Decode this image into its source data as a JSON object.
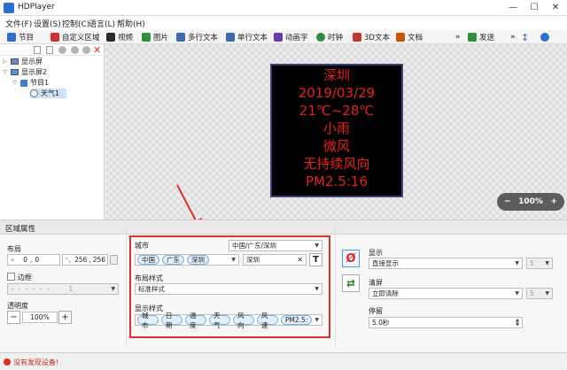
{
  "window": {
    "title": "HDPlayer",
    "controls": [
      "—",
      "☐",
      "✕"
    ]
  },
  "menu": [
    "文件(F)",
    "设置(S)",
    "控制(C)",
    "语言(L)",
    "帮助(H)"
  ],
  "toolbar": {
    "items": [
      {
        "label": "节目",
        "icon": "program-icon",
        "color": "#2e6fd0"
      },
      {
        "label": "自定义区域",
        "icon": "custom-area-icon",
        "color": "#d03030"
      },
      {
        "label": "视频",
        "icon": "video-icon",
        "color": "#2a2a2a"
      },
      {
        "label": "图片",
        "icon": "image-icon",
        "color": "#2f8f3a"
      },
      {
        "label": "多行文本",
        "icon": "multiline-text-icon",
        "color": "#3a6db0"
      },
      {
        "label": "单行文本",
        "icon": "single-line-text-icon",
        "color": "#3a6db0"
      },
      {
        "label": "动画字",
        "icon": "animated-text-icon",
        "color": "#6a3ab0"
      },
      {
        "label": "时钟",
        "icon": "clock-icon",
        "color": "#2f8f3a"
      },
      {
        "label": "3D文本",
        "icon": "3d-text-icon",
        "color": "#c0392b"
      },
      {
        "label": "文档",
        "icon": "document-icon",
        "color": "#d35400"
      }
    ],
    "send_label": "发送"
  },
  "tree": {
    "items": [
      {
        "label": "显示屏",
        "level": 0,
        "expanded": false
      },
      {
        "label": "显示屏2",
        "level": 0,
        "expanded": true
      },
      {
        "label": "节目1",
        "level": 1,
        "expanded": true
      },
      {
        "label": "天气1",
        "level": 2,
        "selected": true
      }
    ]
  },
  "led": {
    "lines": [
      "深圳",
      "2019/03/29",
      "21℃~28℃",
      "小雨",
      "微风",
      "无持续风向",
      "PM2.5:16"
    ],
    "text_color": "#e8211c"
  },
  "zoom": {
    "minus": "−",
    "value": "100%",
    "plus": "+"
  },
  "props": {
    "title": "区域属性",
    "layout_label": "布局",
    "x": "0",
    "y": "0",
    "width": "256",
    "height": "256",
    "border_label": "边框",
    "border_value": "1",
    "opacity_label": "透明度",
    "opacity_value": "100%",
    "city_label": "城市",
    "city_select": "中国/广东/深圳",
    "city_tags": [
      "中国",
      "广东",
      "深圳"
    ],
    "city_search": "深圳",
    "layout_style_label": "布局样式",
    "layout_style_value": "标准样式",
    "display_style_label": "显示样式",
    "display_tags": [
      "城市",
      "日期",
      "温度",
      "天气",
      "风向",
      "风速",
      "PM2.5:"
    ],
    "display_label": "显示",
    "display_value": "直接显示",
    "display_speed": "5",
    "clear_label": "清屏",
    "clear_value": "立即清除",
    "clear_speed": "5",
    "stay_label": "停留",
    "stay_value": "5.0秒"
  },
  "status": {
    "text": "没有发现设备!"
  }
}
